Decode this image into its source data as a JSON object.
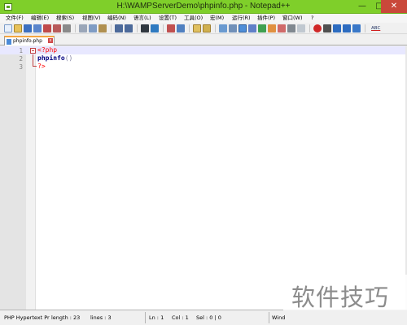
{
  "window": {
    "title": "H:\\WAMPServerDemo\\phpinfo.php - Notepad++",
    "minimize_glyph": "—",
    "maximize_glyph": "□",
    "close_glyph": "✕"
  },
  "menubar": {
    "items": [
      {
        "label": "文件(F)"
      },
      {
        "label": "编辑(E)"
      },
      {
        "label": "搜索(S)"
      },
      {
        "label": "视图(V)"
      },
      {
        "label": "编码(N)"
      },
      {
        "label": "语言(L)"
      },
      {
        "label": "设置(T)"
      },
      {
        "label": "工具(O)"
      },
      {
        "label": "宏(M)"
      },
      {
        "label": "运行(R)"
      },
      {
        "label": "插件(P)"
      },
      {
        "label": "窗口(W)"
      },
      {
        "label": "?"
      }
    ]
  },
  "toolbar": {
    "icons": [
      "new-file-icon",
      "open-file-icon",
      "save-icon",
      "save-all-icon",
      "close-icon",
      "close-all-icon",
      "print-icon",
      "cut-icon",
      "copy-icon",
      "paste-icon",
      "undo-icon",
      "redo-icon",
      "find-icon",
      "replace-icon",
      "zoom-in-icon",
      "zoom-out-icon",
      "sync-v-icon",
      "sync-h-icon",
      "word-wrap-icon",
      "show-all-chars-icon",
      "indent-guide-icon",
      "language-icon",
      "doc-map-icon",
      "function-list-icon",
      "folder-workspace-icon",
      "monitor-icon",
      "record-macro-icon",
      "stop-macro-icon",
      "play-macro-icon",
      "run-macro-multiple-icon",
      "save-macro-icon",
      "spellcheck-icon"
    ],
    "spellcheck_label": "ABC"
  },
  "tabs": [
    {
      "label": "phpinfo.php",
      "close_glyph": "x",
      "active": true
    }
  ],
  "editor": {
    "lines": [
      {
        "number": "1",
        "parts": {
          "tag": "<?php"
        }
      },
      {
        "number": "2",
        "parts": {
          "func": "phpinfo",
          "paren": "()"
        }
      },
      {
        "number": "3",
        "parts": {
          "tag": "?>"
        }
      }
    ]
  },
  "statusbar": {
    "file_type": "PHP Hypertext Pr",
    "length": "length : 23",
    "lines": "lines : 3",
    "ln": "Ln : 1",
    "col": "Col : 1",
    "sel": "Sel : 0 | 0",
    "eol": "Wind"
  },
  "watermark": {
    "text": "软件技巧"
  },
  "colors": {
    "titlebar": "#7fcf2a",
    "close_button": "#c9483a",
    "php_tag": "#ff0000",
    "function": "#000080",
    "current_line": "#e8e8ff",
    "tab_accent": "#f4a640"
  }
}
